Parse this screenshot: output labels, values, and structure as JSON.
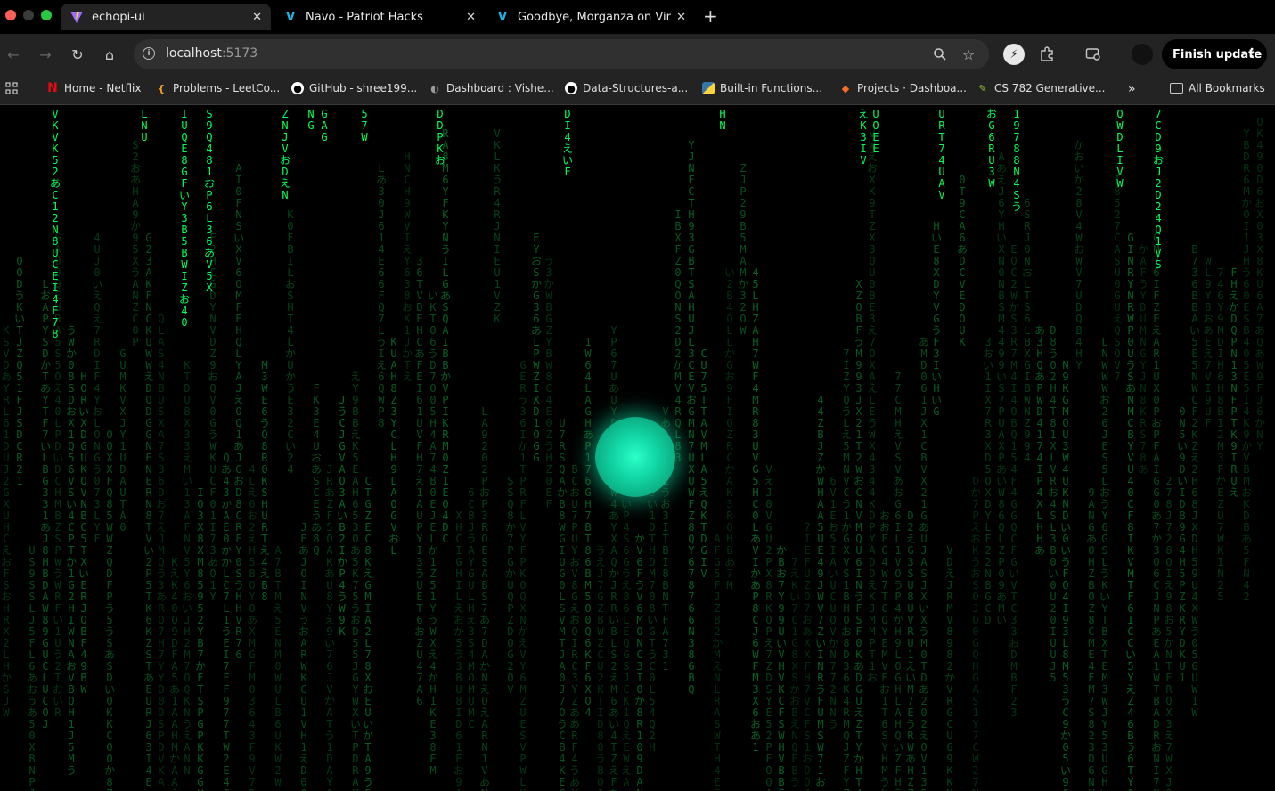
{
  "tabs": [
    {
      "title": "echopi-ui",
      "active": true,
      "favicon": "vite-icon"
    },
    {
      "title": "Navo - Patriot Hacks",
      "active": false,
      "favicon": "vimeo-icon"
    },
    {
      "title": "Goodbye, Morganza on Vimeo",
      "active": false,
      "favicon": "vimeo-icon"
    }
  ],
  "address_bar": {
    "host": "localhost",
    "port": ":5173"
  },
  "toolbar": {
    "finish_update_label": "Finish update"
  },
  "bookmarks": [
    {
      "label": "Home - Netflix",
      "icon": "netflix-icon"
    },
    {
      "label": "Problems - LeetCo...",
      "icon": "leetcode-icon"
    },
    {
      "label": "GitHub - shree199...",
      "icon": "github-icon"
    },
    {
      "label": "Dashboard : Vishe...",
      "icon": "dashboard-icon"
    },
    {
      "label": "Data-Structures-a...",
      "icon": "github-icon"
    },
    {
      "label": "Built-in Functions...",
      "icon": "python-icon"
    },
    {
      "label": "Projects · Dashboa...",
      "icon": "gitlab-icon"
    },
    {
      "label": "CS 782 Generative...",
      "icon": "course-icon"
    }
  ],
  "all_bookmarks_label": "All Bookmarks",
  "colors": {
    "matrix_green": "#00ff55",
    "matrix_dim": "#0a7a2e",
    "orb": "#13d9a8",
    "chrome_bg": "#232323"
  },
  "matrix_columns": [
    "VKVK52あC12N8UCEI4E78",
    "LNU",
    "IUQE8GFいY3B5BWIZお40",
    "S9Q481おP6L36あV5X",
    "ZNJVおDえN",
    "NG",
    "GAG",
    "57W",
    "DDPKお",
    "DI4えいF",
    "HN",
    "えK3IV",
    "UOEE",
    "URT74UAV",
    "おG6RU3W",
    "19788N4Sう",
    "QWDLIVW",
    "7CD9おJ2D24Q1VS",
    "3"
  ]
}
